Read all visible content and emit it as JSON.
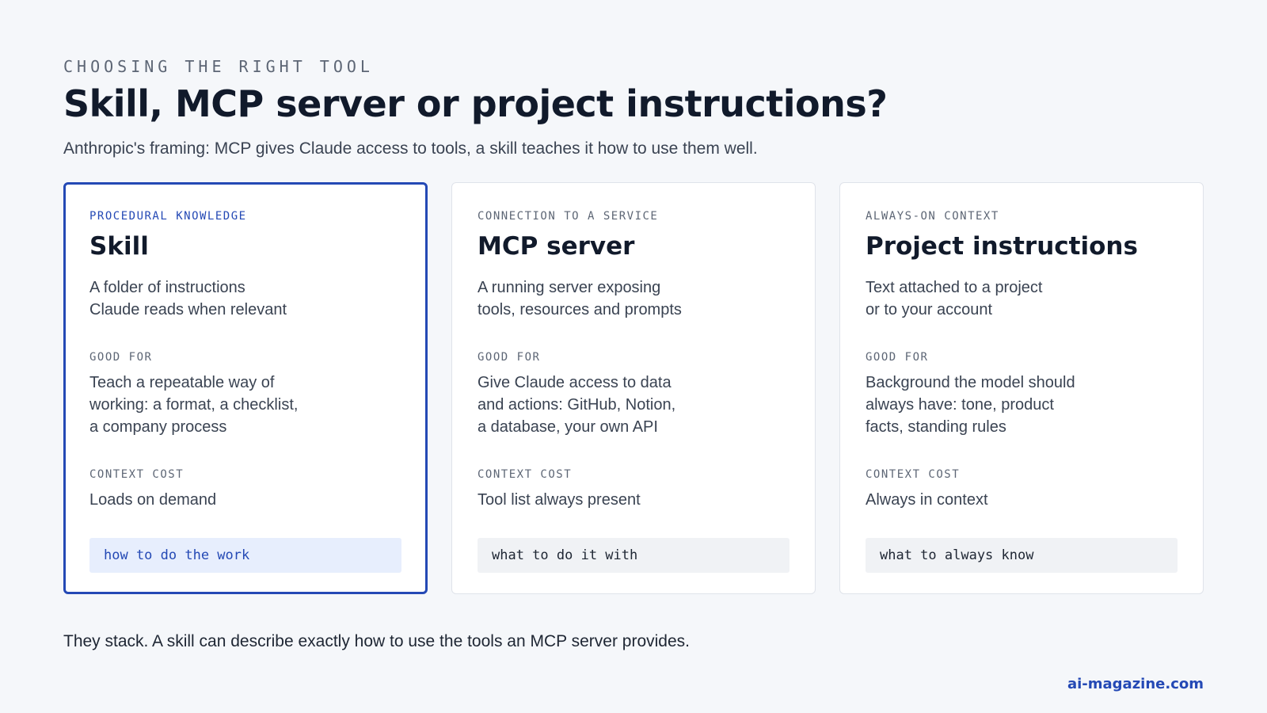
{
  "header": {
    "eyebrow": "CHOOSING THE RIGHT TOOL",
    "title": "Skill, MCP server or project instructions?",
    "subtitle": "Anthropic's framing: MCP gives Claude access to tools, a skill teaches it how to use them well."
  },
  "cards": [
    {
      "kicker": "PROCEDURAL KNOWLEDGE",
      "name": "Skill",
      "desc_lines": [
        "A folder of instructions",
        "Claude reads when relevant"
      ],
      "good_for_label": "GOOD FOR",
      "good_for_lines": [
        "Teach a repeatable way of",
        "working: a format, a checklist,",
        "a company process"
      ],
      "context_cost_label": "CONTEXT COST",
      "context_cost": "Loads on demand",
      "tag": "how to do the work"
    },
    {
      "kicker": "CONNECTION TO A SERVICE",
      "name": "MCP server",
      "desc_lines": [
        "A running server exposing",
        "tools, resources and prompts"
      ],
      "good_for_label": "GOOD FOR",
      "good_for_lines": [
        "Give Claude access to data",
        "and actions: GitHub, Notion,",
        "a database, your own API"
      ],
      "context_cost_label": "CONTEXT COST",
      "context_cost": "Tool list always present",
      "tag": "what to do it with"
    },
    {
      "kicker": "ALWAYS-ON CONTEXT",
      "name": "Project instructions",
      "desc_lines": [
        "Text attached to a project",
        "or to your account"
      ],
      "good_for_label": "GOOD FOR",
      "good_for_lines": [
        "Background the model should",
        "always have: tone, product",
        "facts, standing rules"
      ],
      "context_cost_label": "CONTEXT COST",
      "context_cost": "Always in context",
      "tag": "what to always know"
    }
  ],
  "footer": {
    "note": "They stack. A skill can describe exactly how to use the tools an MCP server provides.",
    "brand": "ai-magazine.com"
  },
  "colors": {
    "accent": "#2449b5",
    "background": "#f5f7fa",
    "card": "#ffffff",
    "highlight_tag": "#e7eefd",
    "tag": "#f0f2f5"
  }
}
